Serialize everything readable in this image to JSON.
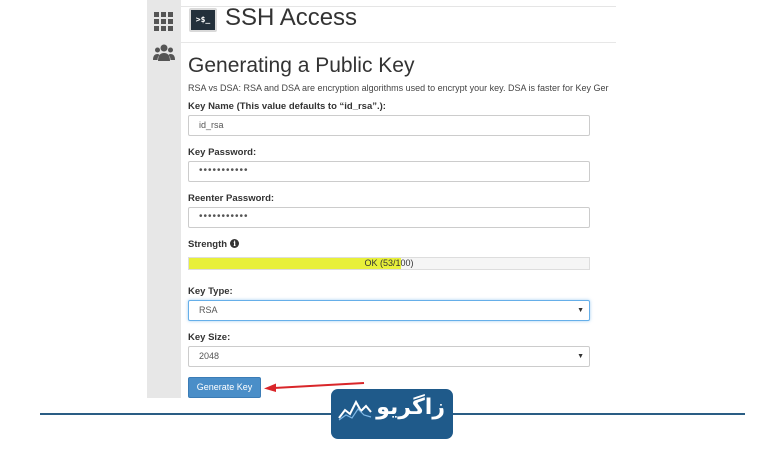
{
  "page": {
    "title": "SSH Access",
    "terminal_icon_text": ">$_"
  },
  "sidebar": {
    "items": [
      {
        "icon": "grid-icon"
      },
      {
        "icon": "users-icon"
      }
    ]
  },
  "form": {
    "section_title": "Generating a Public Key",
    "description": "RSA vs DSA: RSA and DSA are encryption algorithms used to encrypt your key. DSA is faster for Key Ger",
    "key_name": {
      "label": "Key Name (This value defaults to “id_rsa”.):",
      "value": "id_rsa"
    },
    "key_password": {
      "label": "Key Password:",
      "value": "•••••••••••"
    },
    "reenter_password": {
      "label": "Reenter Password:",
      "value": "•••••••••••"
    },
    "strength": {
      "label": "Strength",
      "text": "OK (53/100)",
      "percent": 53,
      "bar_color": "#e8f03a"
    },
    "key_type": {
      "label": "Key Type:",
      "selected": "RSA"
    },
    "key_size": {
      "label": "Key Size:",
      "selected": "2048"
    },
    "generate_button": "Generate Key"
  },
  "watermark": {
    "text": "زاگریو",
    "bg_color": "#1f5a8a"
  },
  "colors": {
    "annotation_arrow": "#d9262a",
    "primary_button": "#4a8ec8"
  }
}
